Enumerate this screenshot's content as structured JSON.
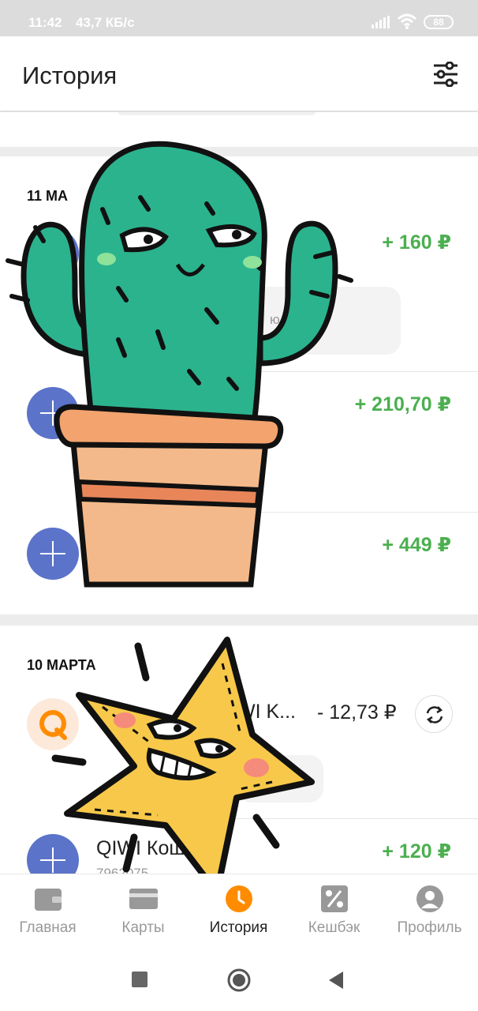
{
  "status_bar": {
    "time": "11:42",
    "speed": "43,7 КБ/с",
    "battery": "88"
  },
  "header": {
    "title": "История",
    "filter_icon": "sliders-icon"
  },
  "groups": [
    {
      "date": "11 МА",
      "transactions": [
        {
          "amount": "+ 160 ₽",
          "icon": "plus-icon",
          "comment_fragment": "ю"
        },
        {
          "amount": "+ 210,70 ₽",
          "icon": "plus-icon"
        },
        {
          "amount": "+ 449 ₽",
          "icon": "plus-icon"
        }
      ]
    },
    {
      "date": "10 МАРТА",
      "transactions": [
        {
          "title_fragment": "WI K...",
          "amount": "- 12,73 ₽",
          "icon": "qiwi-logo-icon",
          "action_icon": "repeat-icon"
        },
        {
          "title": "QIWI Кош",
          "subtitle_fragment": "7962075",
          "amount": "+ 120 ₽",
          "icon": "plus-icon"
        }
      ]
    }
  ],
  "tabs": [
    {
      "label": "Главная",
      "icon": "wallet-icon",
      "active": false
    },
    {
      "label": "Карты",
      "icon": "card-icon",
      "active": false
    },
    {
      "label": "История",
      "icon": "clock-icon",
      "active": true
    },
    {
      "label": "Кешбэк",
      "icon": "percent-icon",
      "active": false
    },
    {
      "label": "Профиль",
      "icon": "profile-icon",
      "active": false
    }
  ],
  "colors": {
    "accent_orange": "#ff8c00",
    "income_green": "#4caf50",
    "plus_blue": "#5b73c9",
    "cactus_green": "#2bb38e",
    "pot_orange": "#f4b98a",
    "star_yellow": "#f7c84a"
  },
  "stickers": [
    "cactus-sticker",
    "star-sticker"
  ]
}
